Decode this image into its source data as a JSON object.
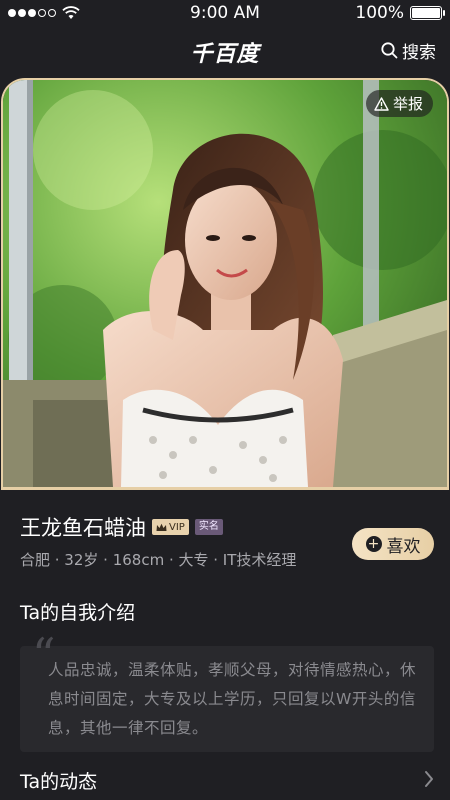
{
  "status_bar": {
    "time": "9:00 AM",
    "battery_text": "100%",
    "battery_level": 1.0
  },
  "header": {
    "title": "千百度",
    "search_label": "搜索"
  },
  "photo": {
    "report_label": "举报",
    "border_color": "#e6cfa6"
  },
  "profile": {
    "name": "王龙鱼石蜡油",
    "vip_label": "VIP",
    "verified_label": "实名",
    "details": "合肥 · 32岁 · 168cm · 大专 · IT技术经理",
    "like_label": "喜欢"
  },
  "intro": {
    "title": "Ta的自我介绍",
    "text": "人品忠诚，温柔体贴，孝顺父母，对待情感热心，休息时间固定，大专及以上学历，只回复以W开头的信息，其他一律不回复。"
  },
  "feed": {
    "title": "Ta的动态"
  },
  "colors": {
    "accent": "#e8d2ad",
    "background": "#1f1f23",
    "panel": "#29292d"
  }
}
